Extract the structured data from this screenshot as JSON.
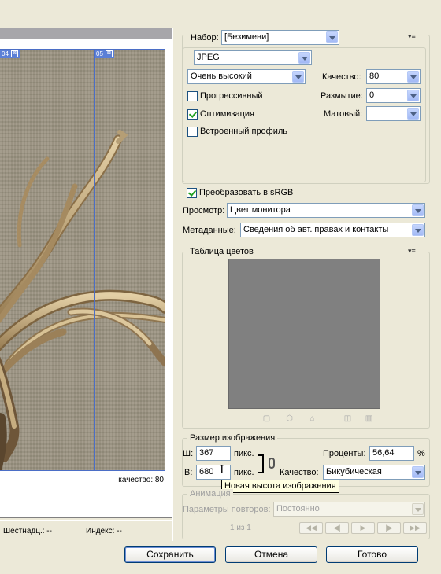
{
  "preview": {
    "slice_tag_left": "04",
    "slice_tag_right": "05",
    "quality_note": "качество: 80",
    "hex_label": "Шестнадц.: --",
    "index_label": "Индекс: --"
  },
  "settings": {
    "preset_label": "Набор:",
    "preset_value": "[Безимени]",
    "format_value": "JPEG",
    "compression_value": "Очень высокий",
    "quality_label": "Качество:",
    "quality_value": "80",
    "progressive_label": "Прогрессивный",
    "blur_label": "Размытие:",
    "blur_value": "0",
    "optimized_label": "Оптимизация",
    "matte_label": "Матовый:",
    "matte_value": "",
    "embed_profile_label": "Встроенный профиль",
    "checkboxes": {
      "progressive": false,
      "optimized": true,
      "embed_profile": false,
      "srgb": true
    },
    "menu_icon": "▾≡"
  },
  "color_options": {
    "srgb_label": "Преобразовать в sRGB",
    "preview_label": "Просмотр:",
    "preview_value": "Цвет монитора",
    "metadata_label": "Метаданные:",
    "metadata_value": "Сведения об авт. правах и контакты"
  },
  "color_table": {
    "title": "Таблица цветов",
    "swatch_color": "#808080",
    "toolbar_icons": [
      "map-to-web-icon",
      "cube-icon",
      "lock-icon",
      "new-color-icon",
      "trash-icon"
    ]
  },
  "image_size": {
    "title": "Размер изображения",
    "width_label": "Ш:",
    "width_value": "367",
    "height_label": "В:",
    "height_value": "680",
    "unit": "пикс.",
    "percent_label": "Проценты:",
    "percent_value": "56,64",
    "percent_unit": "%",
    "quality_label": "Качество:",
    "quality_value": "Бикубическая",
    "tooltip": "Новая высота изображения"
  },
  "animation": {
    "title": "Анимация",
    "loop_label": "Параметры повторов:",
    "loop_value": "Постоянно",
    "frame_counter": "1 из 1",
    "controls": [
      "◀◀",
      "◀|",
      "▶",
      "|▶",
      "▶▶"
    ]
  },
  "buttons": {
    "save": "Сохранить",
    "cancel": "Отмена",
    "done": "Готово"
  }
}
